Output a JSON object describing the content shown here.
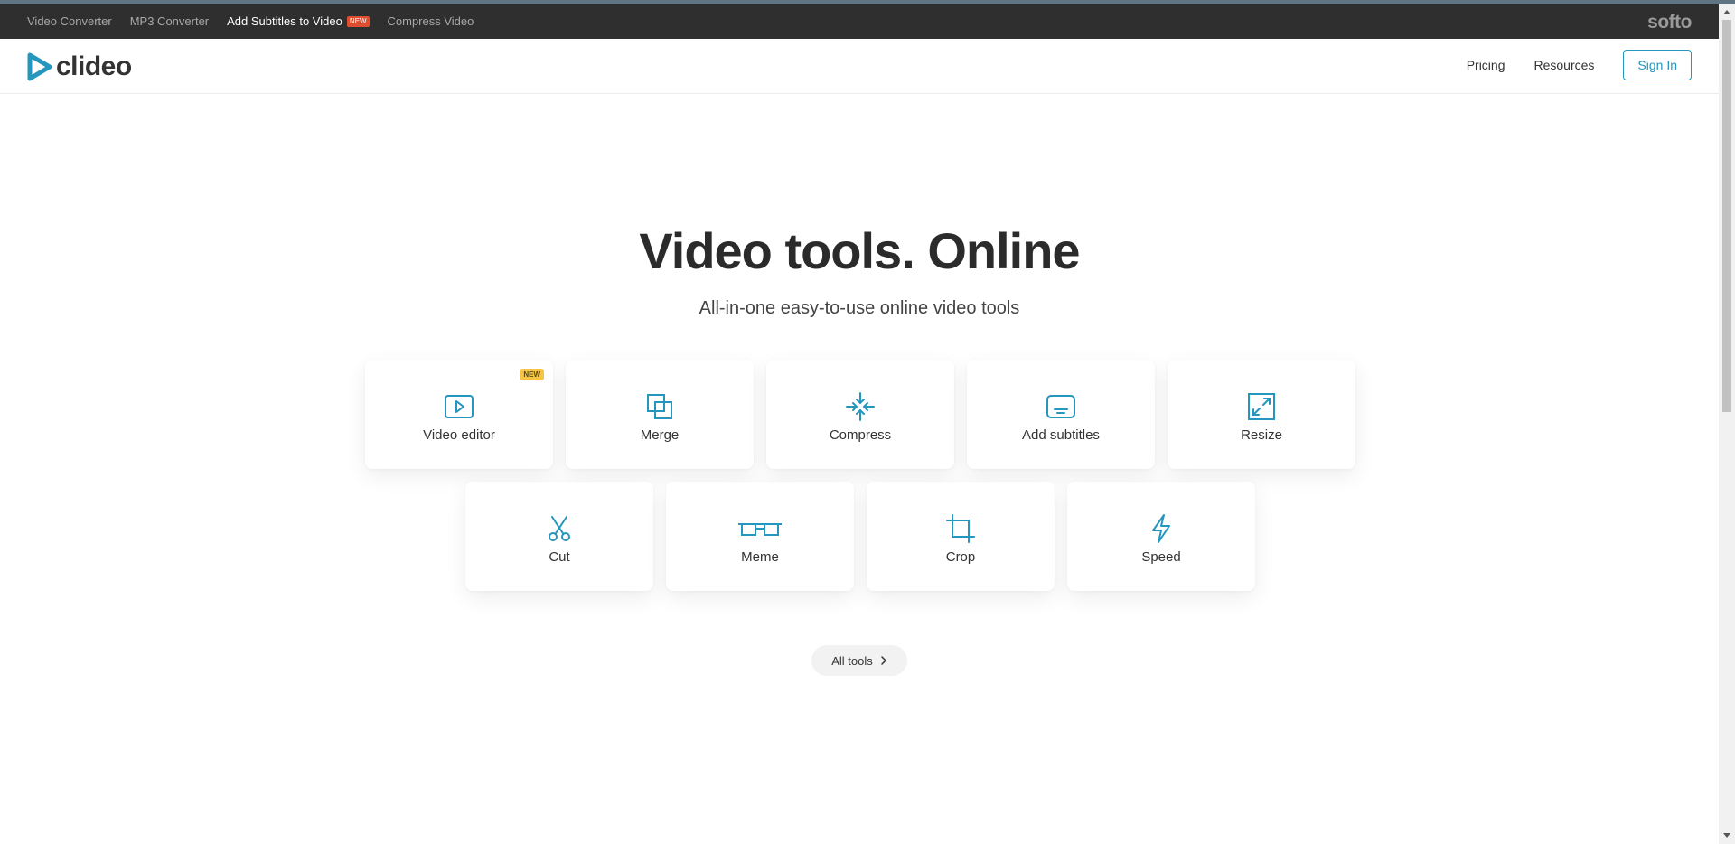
{
  "topbar": {
    "links": [
      {
        "label": "Video Converter"
      },
      {
        "label": "MP3 Converter"
      },
      {
        "label": "Add Subtitles to Video",
        "badge": "NEW"
      },
      {
        "label": "Compress Video"
      }
    ],
    "brand": "softo"
  },
  "header": {
    "logo_text": "clideo",
    "nav": {
      "pricing": "Pricing",
      "resources": "Resources",
      "sign_in": "Sign In"
    }
  },
  "hero": {
    "title": "Video tools. Online",
    "subtitle": "All-in-one easy-to-use online video tools"
  },
  "tools": [
    {
      "label": "Video editor",
      "icon": "play-icon",
      "badge": "NEW"
    },
    {
      "label": "Merge",
      "icon": "merge-icon"
    },
    {
      "label": "Compress",
      "icon": "compress-icon"
    },
    {
      "label": "Add subtitles",
      "icon": "subtitles-icon"
    },
    {
      "label": "Resize",
      "icon": "resize-icon"
    },
    {
      "label": "Cut",
      "icon": "scissors-icon"
    },
    {
      "label": "Meme",
      "icon": "meme-icon"
    },
    {
      "label": "Crop",
      "icon": "crop-icon"
    },
    {
      "label": "Speed",
      "icon": "lightning-icon"
    }
  ],
  "all_tools": "All tools",
  "colors": {
    "accent": "#2596be",
    "topbar_bg": "#2f2f2f",
    "new_badge_red": "#e04e32",
    "new_badge_yellow": "#f6c544"
  }
}
